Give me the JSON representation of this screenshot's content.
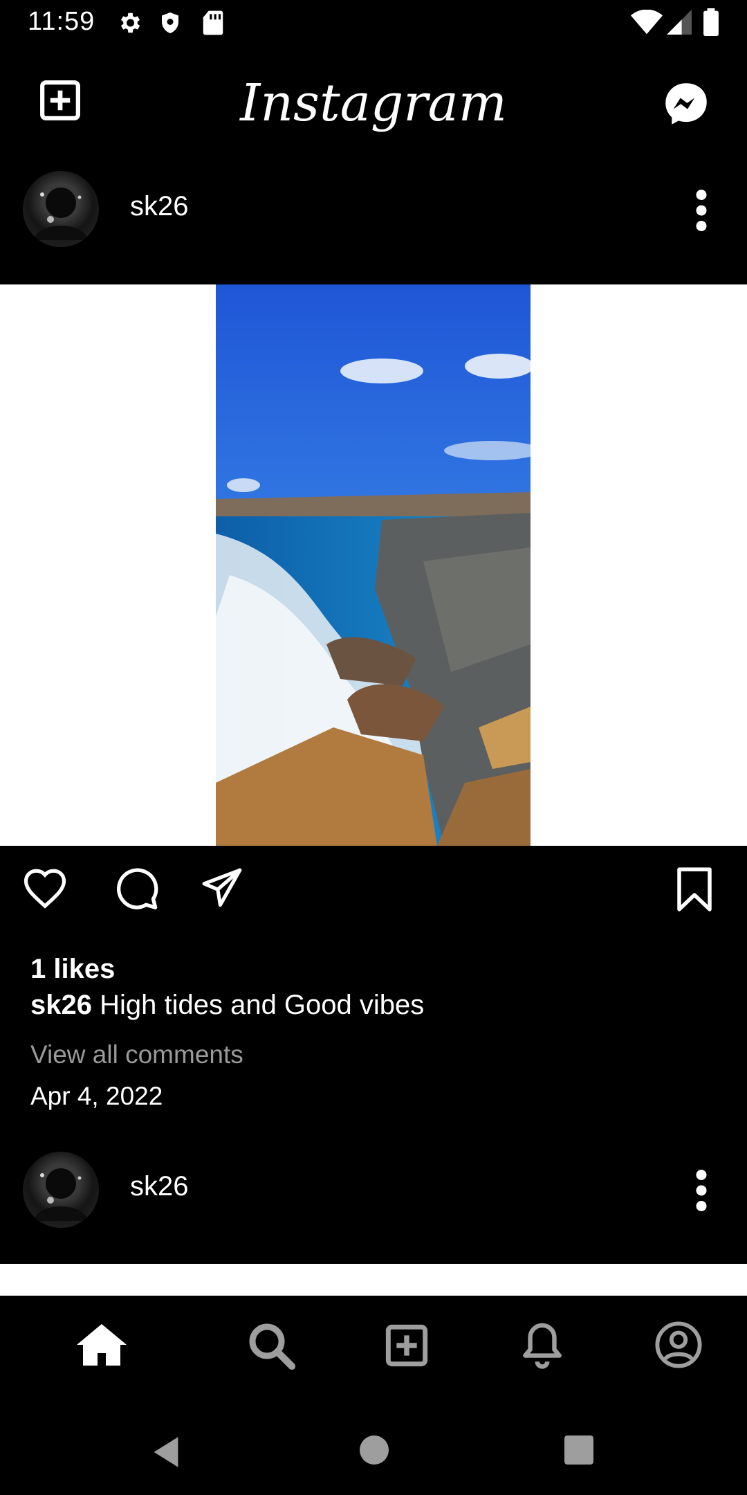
{
  "status_bar": {
    "time": "11:59",
    "icons": [
      "settings-icon",
      "shield-icon",
      "sd-card-icon",
      "wifi-icon",
      "signal-icon",
      "battery-icon"
    ]
  },
  "header": {
    "title": "Instagram",
    "left_icon": "add-post-icon",
    "right_icon": "messenger-icon"
  },
  "post": {
    "username": "sk26",
    "likes": "1 likes",
    "caption_user": "sk26",
    "caption_text": " High tides and Good vibes",
    "view_comments": "View all comments",
    "date": "Apr 4, 2022"
  },
  "next_post": {
    "username": "sk26"
  },
  "bottom_nav": [
    "home-icon",
    "search-icon",
    "add-icon",
    "notifications-icon",
    "profile-icon"
  ],
  "system_nav": [
    "back-icon",
    "home-circle-icon",
    "recents-icon"
  ],
  "colors": {
    "background": "#000000",
    "text": "#ffffff",
    "muted": "#9a9a9a",
    "media_bg": "#ffffff"
  }
}
